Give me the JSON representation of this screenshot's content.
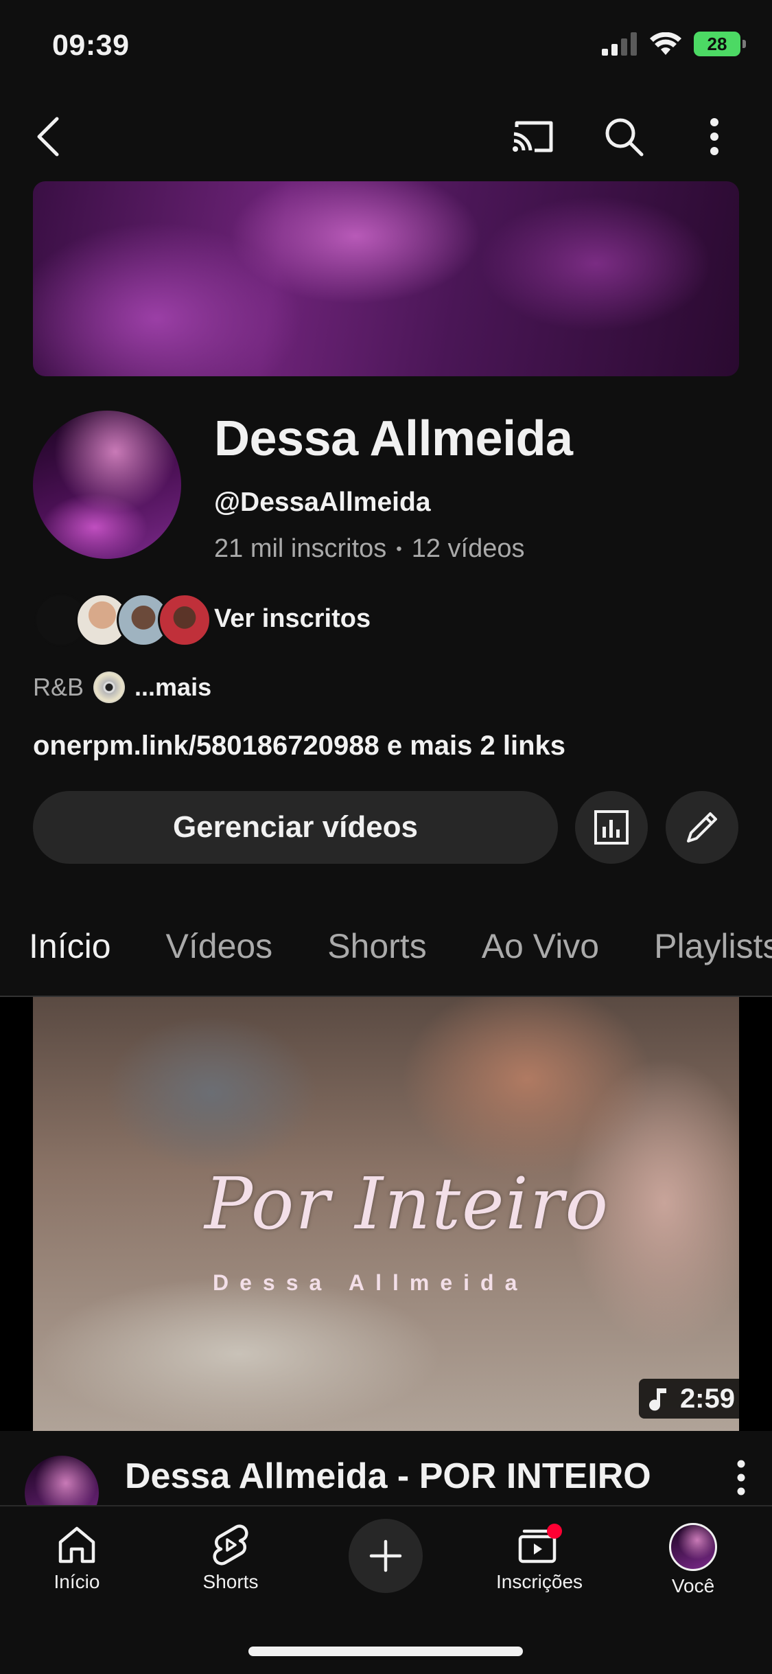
{
  "status_bar": {
    "time": "09:39",
    "battery": "28"
  },
  "channel": {
    "name": "Dessa Allmeida",
    "handle": "@DessaAllmeida",
    "subscribers": "21 mil inscritos",
    "separator": "•",
    "videos": "12 vídeos",
    "see_subscribers": "Ver inscritos",
    "genre": "R&B",
    "more": "...mais",
    "link": "onerpm.link/580186720988",
    "more_links": " e mais 2 links",
    "manage_label": "Gerenciar vídeos"
  },
  "tabs": [
    {
      "label": "Início"
    },
    {
      "label": "Vídeos"
    },
    {
      "label": "Shorts"
    },
    {
      "label": "Ao Vivo"
    },
    {
      "label": "Playlists"
    }
  ],
  "featured_video": {
    "thumbnail_title": "Por Inteiro",
    "thumbnail_subtitle": "Dessa Allmeida",
    "duration": "2:59",
    "title": "Dessa Allmeida - POR INTEIRO"
  },
  "bottom_nav": [
    {
      "label": "Início",
      "icon": "home-icon"
    },
    {
      "label": "Shorts",
      "icon": "shorts-icon"
    },
    {
      "label": "Inscrições",
      "icon": "subscriptions-icon"
    },
    {
      "label": "Você",
      "icon": "avatar"
    }
  ],
  "colors": {
    "background": "#0f0f0f",
    "button": "#272727",
    "notification": "#ff0033",
    "battery": "#4cd964"
  }
}
